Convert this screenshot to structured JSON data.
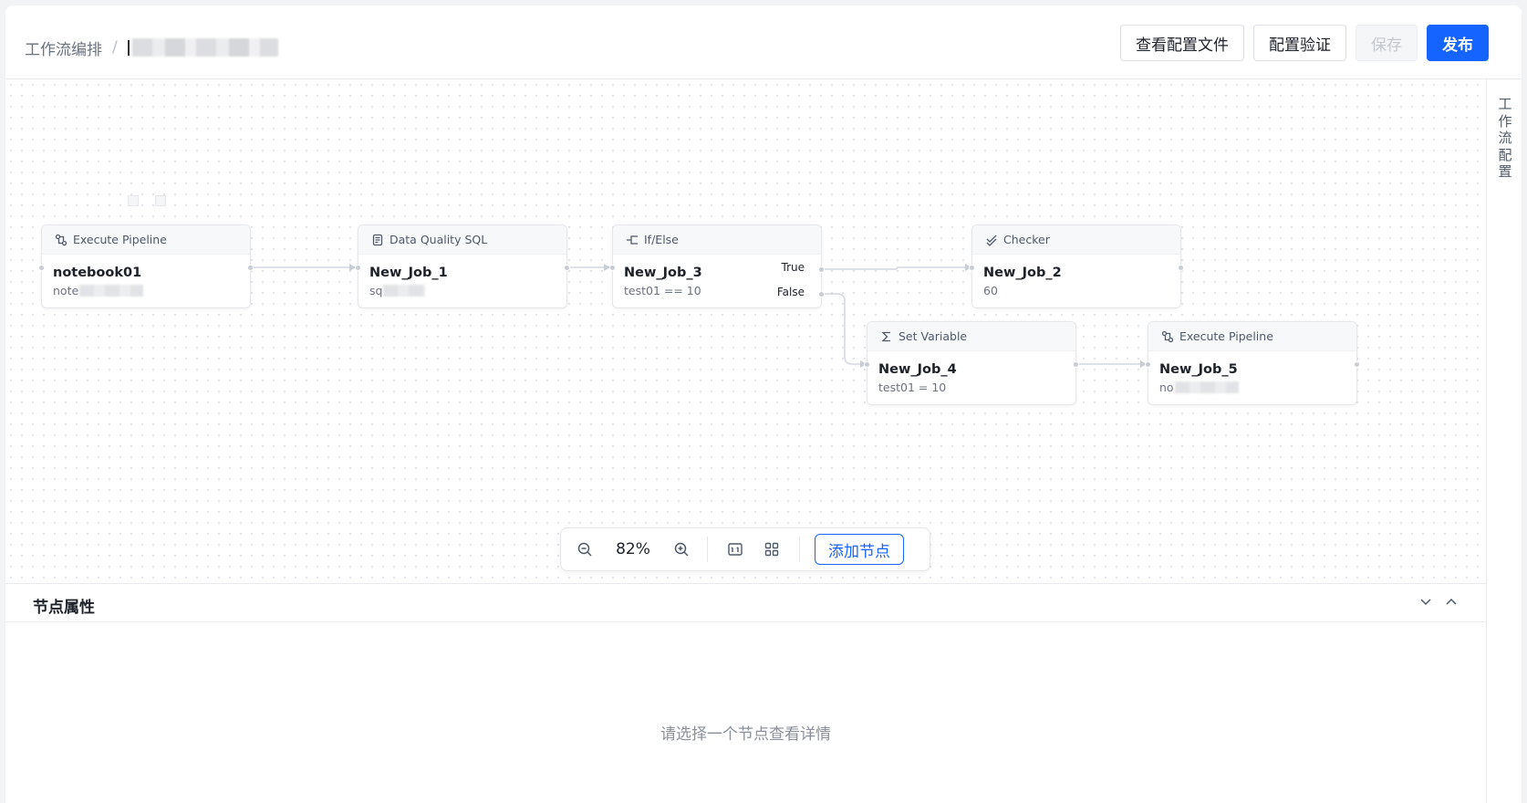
{
  "header": {
    "breadcrumb_root": "工作流编排",
    "breadcrumb_sep": "/",
    "actions": {
      "view_config": "查看配置文件",
      "validate": "配置验证",
      "save": "保存",
      "publish": "发布"
    }
  },
  "nodes": [
    {
      "type": "Execute Pipeline",
      "icon": "pipeline-icon",
      "title": "notebook01",
      "sub": "note"
    },
    {
      "type": "Data Quality SQL",
      "icon": "document-icon",
      "title": "New_Job_1",
      "sub": "sq"
    },
    {
      "type": "If/Else",
      "icon": "branch-icon",
      "title": "New_Job_3",
      "sub": "test01 == 10",
      "true_label": "True",
      "false_label": "False"
    },
    {
      "type": "Checker",
      "icon": "check-icon",
      "title": "New_Job_2",
      "sub": "60"
    },
    {
      "type": "Set Variable",
      "icon": "sigma-icon",
      "title": "New_Job_4",
      "sub": "test01 = 10"
    },
    {
      "type": "Execute Pipeline",
      "icon": "pipeline-icon",
      "title": "New_Job_5",
      "sub": "no"
    }
  ],
  "toolbar": {
    "zoom": "82%",
    "add_node": "添加节点",
    "icons": [
      "zoom-out-icon",
      "zoom-in-icon",
      "actual-size-icon",
      "fit-view-icon"
    ]
  },
  "panel": {
    "title": "节点属性",
    "empty_text": "请选择一个节点查看详情"
  },
  "rail": {
    "label": "工作流配置"
  },
  "colors": {
    "primary": "#1664ff",
    "border": "#e5e7eb",
    "text_secondary": "#6b7280"
  }
}
